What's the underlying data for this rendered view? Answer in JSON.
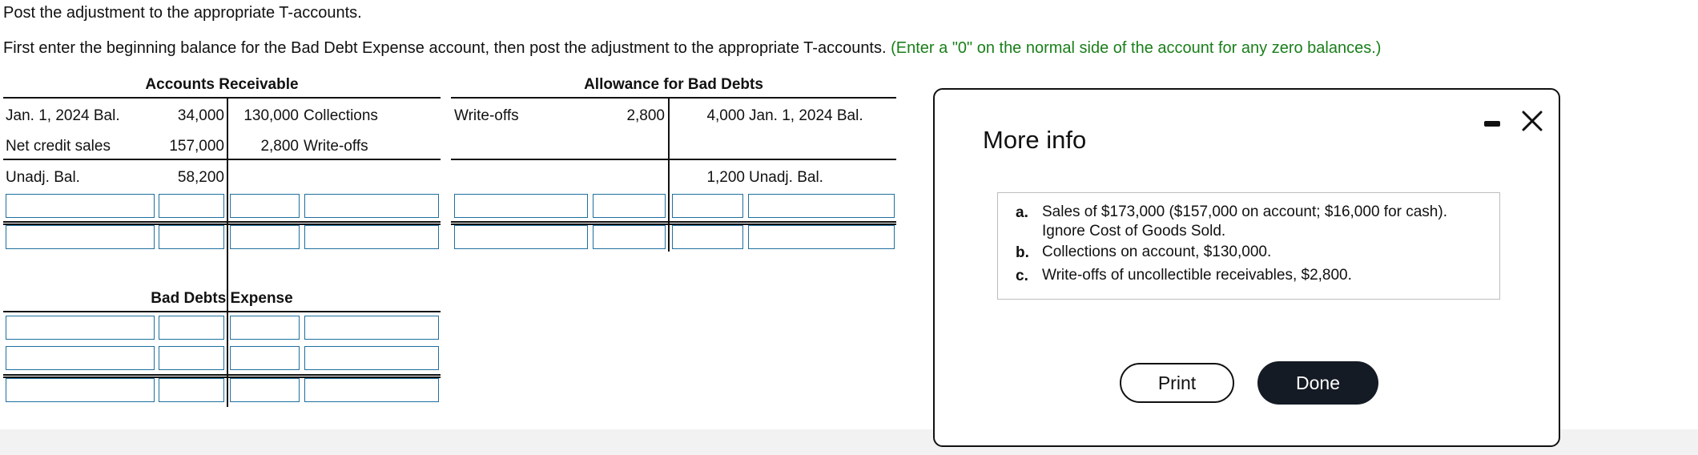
{
  "instructions": {
    "line1": "Post the adjustment to the appropriate T-accounts.",
    "line2": "First enter the beginning balance for the Bad Debt Expense account, then post the adjustment to the appropriate T-accounts.",
    "line2_hint": "(Enter a \"0\" on the normal side of the account for any zero balances.)"
  },
  "accounts_receivable": {
    "title": "Accounts Receivable",
    "rows": [
      {
        "left_label": "Jan. 1, 2024 Bal.",
        "left_amount": "34,000",
        "right_amount": "130,000",
        "right_label": "Collections"
      },
      {
        "left_label": "Net credit sales",
        "left_amount": "157,000",
        "right_amount": "2,800",
        "right_label": "Write-offs"
      }
    ],
    "balance": {
      "left_label": "Unadj. Bal.",
      "left_amount": "58,200"
    }
  },
  "allowance": {
    "title": "Allowance for Bad Debts",
    "rows": [
      {
        "left_label": "Write-offs",
        "left_amount": "2,800",
        "right_amount": "4,000",
        "right_label": "Jan. 1, 2024 Bal."
      }
    ],
    "balance": {
      "right_amount": "1,200",
      "right_label": "Unadj. Bal."
    }
  },
  "bad_debts_expense": {
    "title": "Bad Debts Expense"
  },
  "modal": {
    "title": "More info",
    "items": [
      {
        "label": "a.",
        "text": "Sales of $173,000 ($157,000 on account; $16,000 for cash). Ignore Cost of Goods Sold."
      },
      {
        "label": "b.",
        "text": "Collections on account, $130,000."
      },
      {
        "label": "c.",
        "text": "Write-offs of uncollectible receivables, $2,800."
      }
    ],
    "print_label": "Print",
    "done_label": "Done"
  }
}
